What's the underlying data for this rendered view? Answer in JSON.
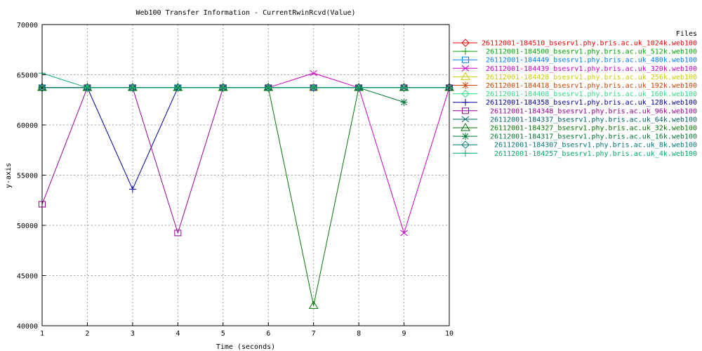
{
  "chart_data": {
    "type": "line",
    "title": "Web100 Transfer Information - CurrentRwinRcvd(Value)",
    "xlabel": "Time (seconds)",
    "ylabel": "y-axis",
    "xlim": [
      1,
      10
    ],
    "ylim": [
      40000,
      70000
    ],
    "xticks": [
      1,
      2,
      3,
      4,
      5,
      6,
      7,
      8,
      9,
      10
    ],
    "yticks": [
      40000,
      45000,
      50000,
      55000,
      60000,
      65000,
      70000
    ],
    "grid": true,
    "legend_title": "Files",
    "legend_position": "right",
    "series": [
      {
        "name": "26112001-184510_bsesrv1.phy.bris.ac.uk_1024k.web100",
        "color": "#ff0000",
        "marker": "diamond",
        "points": [
          [
            1,
            63712
          ],
          [
            2,
            63712
          ],
          [
            3,
            63712
          ],
          [
            4,
            63712
          ],
          [
            5,
            63712
          ],
          [
            6,
            63712
          ],
          [
            7,
            63712
          ],
          [
            8,
            63712
          ],
          [
            9,
            63712
          ],
          [
            10,
            63712
          ]
        ]
      },
      {
        "name": "26112001-184500_bsesrv1.phy.bris.ac.uk_512k.web100",
        "color": "#00aa00",
        "marker": "plus",
        "points": [
          [
            1,
            63712
          ],
          [
            2,
            63712
          ],
          [
            3,
            63712
          ],
          [
            4,
            63712
          ],
          [
            5,
            63712
          ],
          [
            6,
            63712
          ],
          [
            7,
            63712
          ],
          [
            8,
            63712
          ],
          [
            9,
            63712
          ],
          [
            10,
            63712
          ]
        ]
      },
      {
        "name": "26112001-184449_bsesrv1.phy.bris.ac.uk_480k.web100",
        "color": "#0080ff",
        "marker": "square",
        "points": [
          [
            1,
            63712
          ],
          [
            2,
            63712
          ],
          [
            3,
            63712
          ],
          [
            4,
            63712
          ],
          [
            5,
            63712
          ],
          [
            6,
            63712
          ],
          [
            7,
            63712
          ],
          [
            8,
            63712
          ],
          [
            9,
            63712
          ],
          [
            10,
            63712
          ]
        ]
      },
      {
        "name": "26112001-184439_bsesrv1.phy.bris.ac.uk_320k.web100",
        "color": "#cc00cc",
        "marker": "x",
        "points": [
          [
            1,
            63712
          ],
          [
            2,
            63712
          ],
          [
            3,
            63712
          ],
          [
            4,
            63712
          ],
          [
            5,
            63712
          ],
          [
            6,
            63712
          ],
          [
            7,
            65160
          ],
          [
            8,
            63712
          ],
          [
            9,
            49240
          ],
          [
            10,
            63712
          ]
        ]
      },
      {
        "name": "26112001-184428_bsesrv1.phy.bris.ac.uk_256k.web100",
        "color": "#cccc00",
        "marker": "triangle",
        "points": [
          [
            1,
            63712
          ],
          [
            2,
            63712
          ],
          [
            3,
            63712
          ],
          [
            4,
            63712
          ],
          [
            5,
            63712
          ],
          [
            6,
            63712
          ],
          [
            7,
            63712
          ],
          [
            8,
            63712
          ],
          [
            9,
            63712
          ],
          [
            10,
            63712
          ]
        ]
      },
      {
        "name": "26112001-184418_bsesrv1.phy.bris.ac.uk_192k.web100",
        "color": "#cc4400",
        "marker": "star",
        "points": [
          [
            1,
            63712
          ],
          [
            2,
            63712
          ],
          [
            3,
            63712
          ],
          [
            4,
            63712
          ],
          [
            5,
            63712
          ],
          [
            6,
            63712
          ],
          [
            7,
            63712
          ],
          [
            8,
            63712
          ],
          [
            9,
            63712
          ],
          [
            10,
            63712
          ]
        ]
      },
      {
        "name": "26112001-184408_bsesrv1.phy.bris.ac.uk_160k.web100",
        "color": "#33dd88",
        "marker": "diamond",
        "points": [
          [
            1,
            63712
          ],
          [
            2,
            63712
          ],
          [
            3,
            63712
          ],
          [
            4,
            63712
          ],
          [
            5,
            63712
          ],
          [
            6,
            63712
          ],
          [
            7,
            63712
          ],
          [
            8,
            63712
          ],
          [
            9,
            63712
          ],
          [
            10,
            63712
          ]
        ]
      },
      {
        "name": "26112001-184358_bsesrv1.phy.bris.ac.uk_128k.web100",
        "color": "#000099",
        "marker": "plus",
        "points": [
          [
            1,
            63712
          ],
          [
            2,
            63712
          ],
          [
            3,
            53600
          ],
          [
            4,
            63712
          ],
          [
            5,
            63712
          ],
          [
            6,
            63712
          ],
          [
            7,
            63712
          ],
          [
            8,
            63712
          ],
          [
            9,
            63712
          ],
          [
            10,
            63712
          ]
        ]
      },
      {
        "name": "26112001-184348_bsesrv1.phy.bris.ac.uk_96k.web100",
        "color": "#990099",
        "marker": "square",
        "points": [
          [
            1,
            52100
          ],
          [
            2,
            63712
          ],
          [
            3,
            63712
          ],
          [
            4,
            49240
          ],
          [
            5,
            63712
          ],
          [
            6,
            63712
          ],
          [
            7,
            63712
          ],
          [
            8,
            63712
          ],
          [
            9,
            63712
          ],
          [
            10,
            63712
          ]
        ]
      },
      {
        "name": "26112001-184337_bsesrv1.phy.bris.ac.uk_64k.web100",
        "color": "#006666",
        "marker": "x",
        "points": [
          [
            1,
            63712
          ],
          [
            2,
            63712
          ],
          [
            3,
            63712
          ],
          [
            4,
            63712
          ],
          [
            5,
            63712
          ],
          [
            6,
            63712
          ],
          [
            7,
            63712
          ],
          [
            8,
            63712
          ],
          [
            9,
            63712
          ],
          [
            10,
            63712
          ]
        ]
      },
      {
        "name": "26112001-184327_bsesrv1.phy.bris.ac.uk_32k.web100",
        "color": "#007700",
        "marker": "triangle",
        "points": [
          [
            1,
            63712
          ],
          [
            2,
            63712
          ],
          [
            3,
            63712
          ],
          [
            4,
            63712
          ],
          [
            5,
            63712
          ],
          [
            6,
            63712
          ],
          [
            7,
            42000
          ],
          [
            8,
            63712
          ],
          [
            9,
            63712
          ],
          [
            10,
            63712
          ]
        ]
      },
      {
        "name": "26112001-184317_bsesrv1.phy.bris.ac.uk_16k.web100",
        "color": "#007733",
        "marker": "star",
        "points": [
          [
            1,
            63712
          ],
          [
            2,
            63712
          ],
          [
            3,
            63712
          ],
          [
            4,
            63712
          ],
          [
            5,
            63712
          ],
          [
            6,
            63712
          ],
          [
            7,
            63712
          ],
          [
            8,
            63712
          ],
          [
            9,
            62264
          ]
        ]
      },
      {
        "name": "26112001-184307_bsesrv1.phy.bris.ac.uk_8k.web100",
        "color": "#007777",
        "marker": "diamond",
        "points": [
          [
            1,
            63712
          ],
          [
            2,
            63712
          ],
          [
            3,
            63712
          ],
          [
            4,
            63712
          ],
          [
            5,
            63712
          ],
          [
            6,
            63712
          ],
          [
            7,
            63712
          ],
          [
            8,
            63712
          ],
          [
            9,
            63712
          ],
          [
            10,
            63712
          ]
        ]
      },
      {
        "name": "26112001-184257_bsesrv1.phy.bris.ac.uk_4k.web100",
        "color": "#00aa66",
        "marker": "plus",
        "points": [
          [
            1,
            65160
          ],
          [
            2,
            63712
          ],
          [
            3,
            63712
          ],
          [
            4,
            63712
          ],
          [
            5,
            63712
          ],
          [
            6,
            63712
          ],
          [
            7,
            63712
          ],
          [
            8,
            63712
          ],
          [
            9,
            63712
          ],
          [
            10,
            63712
          ]
        ]
      }
    ]
  }
}
